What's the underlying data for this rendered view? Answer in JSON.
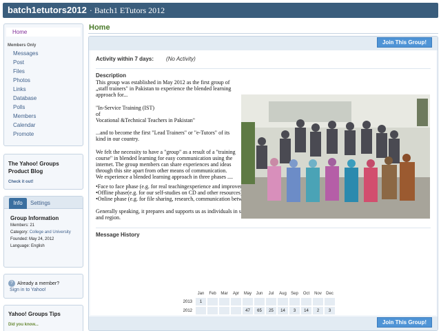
{
  "header": {
    "group_name": "batch1etutors2012",
    "group_title": "· Batch1 ETutors 2012"
  },
  "sidebar": {
    "home_label": "Home",
    "section_label": "Members Only",
    "items": [
      "Messages",
      "Post",
      "Files",
      "Photos",
      "Links",
      "Database",
      "Polls",
      "Members",
      "Calendar",
      "Promote"
    ]
  },
  "blog": {
    "title_line1": "The Yahoo! Groups",
    "title_line2": "Product Blog",
    "link": "Check it out!"
  },
  "info": {
    "tab_info": "Info",
    "tab_settings": "Settings",
    "title": "Group Information",
    "members_label": "Members:",
    "members_value": "21",
    "category_label": "Category:",
    "category_value": "College and University",
    "founded_label": "Founded:",
    "founded_value": "May 24, 2012",
    "language_label": "Language:",
    "language_value": "English"
  },
  "member_box": {
    "question": "Already a member?",
    "signin": "Sign in to Yahoo!"
  },
  "tips": {
    "title": "Yahoo! Groups Tips",
    "did_you_know": "Did you know..."
  },
  "main": {
    "page_title": "Home",
    "join_label": "Join This Group!",
    "activity_label": "Activity within 7 days:",
    "activity_value": "(No Activity)",
    "description_title": "Description",
    "desc_p1": "This group was established in May 2012 as the first group of „staff trainers\" in Pakistan to experience the blended learning approach for...",
    "desc_p2_l1": "\"In-Service Training (IST)",
    "desc_p2_l2": "of",
    "desc_p2_l3": "Vocational &Technical Teachers in Pakistan\"",
    "desc_p3": "...and to become the first \"Lead Trainers\" or \"e-Tutors\" of its kind in our country.",
    "desc_p4": "We felt the necessity to have a \"group\" as a result of a \"training course\" in blended learning for easy communication using the internet. The group members can share experiences and ideas through this site apart from other means of communication.",
    "desc_p5": "We experience a blended learning approach in three phases ....",
    "phase1": "•Face to face phase (e.g. for real teachingexperience and improvement of our pedagogical skills)",
    "phase2": "•Offline phase(e.g. for our self-studies on CD and other resources)",
    "phase3": "•Online phase (e.g. for file sharing, research, communication between various regions)",
    "desc_p6": "Generally speaking, it prepares and supports us as individuals in self-organised and self-paced learning which we intend to spread into our institution and region.",
    "history_title": "Message History"
  },
  "history": {
    "months": [
      "Jan",
      "Feb",
      "Mar",
      "Apr",
      "May",
      "Jun",
      "Jul",
      "Aug",
      "Sep",
      "Oct",
      "Nov",
      "Dec"
    ],
    "rows": [
      {
        "year": "2013",
        "counts": [
          "1",
          "",
          "",
          "",
          "",
          "",
          "",
          "",
          "",
          "",
          "",
          ""
        ]
      },
      {
        "year": "2012",
        "counts": [
          "",
          "",
          "",
          "",
          "47",
          "65",
          "25",
          "14",
          "3",
          "14",
          "2",
          "3"
        ]
      }
    ]
  },
  "colors": {
    "header_bg": "#3a5d7c",
    "link": "#3e5f8a",
    "title_green": "#4a7a2a",
    "join_button": "#4f94d6"
  }
}
